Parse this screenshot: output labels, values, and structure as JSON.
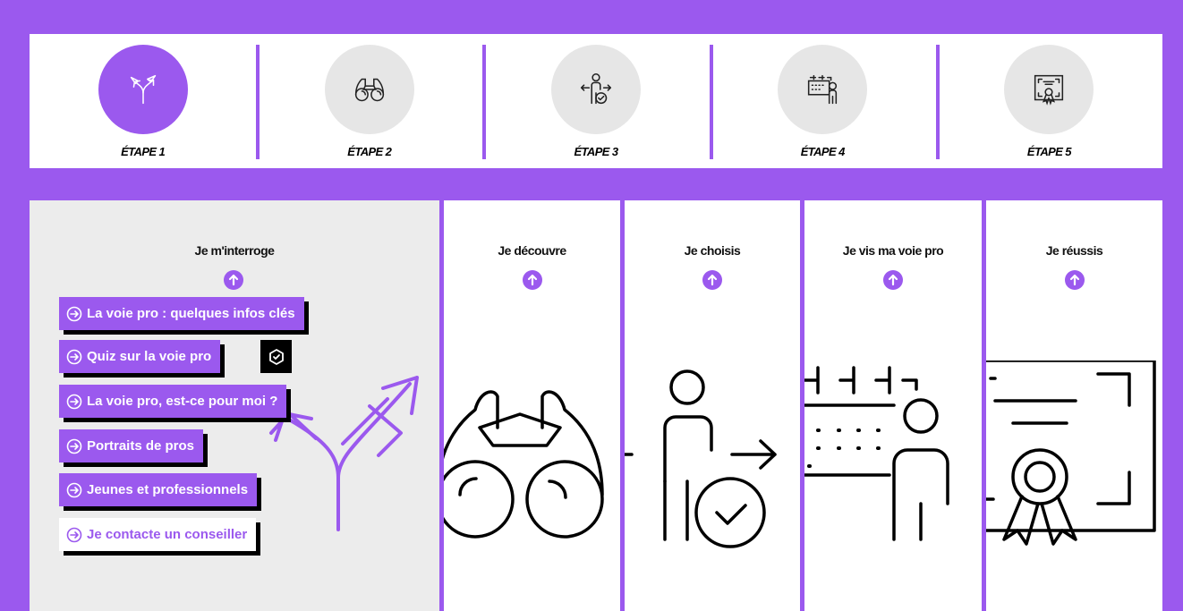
{
  "steps": [
    {
      "label": "ÉTAPE 1",
      "icon": "crossroads-arrows-icon",
      "active": true
    },
    {
      "label": "ÉTAPE 2",
      "icon": "binoculars-icon",
      "active": false
    },
    {
      "label": "ÉTAPE 3",
      "icon": "person-choice-icon",
      "active": false
    },
    {
      "label": "ÉTAPE 4",
      "icon": "calendar-person-icon",
      "active": false
    },
    {
      "label": "ÉTAPE 5",
      "icon": "certificate-icon",
      "active": false
    }
  ],
  "panels": [
    {
      "title": "Je m'interroge"
    },
    {
      "title": "Je découvre"
    },
    {
      "title": "Je choisis"
    },
    {
      "title": "Je vis ma voie pro"
    },
    {
      "title": "Je réussis"
    }
  ],
  "menu": [
    {
      "label": "La voie pro : quelques infos clés"
    },
    {
      "label": "Quiz sur la voie pro",
      "badge_icon": "cube-check-icon"
    },
    {
      "label": "La voie pro, est-ce pour moi ?"
    },
    {
      "label": "Portraits de pros"
    },
    {
      "label": "Jeunes et professionnels"
    },
    {
      "label": "Je contacte un conseiller"
    }
  ],
  "colors": {
    "accent": "#9b59ee",
    "panel_active_bg": "#ececec",
    "shadow": "#000000"
  }
}
